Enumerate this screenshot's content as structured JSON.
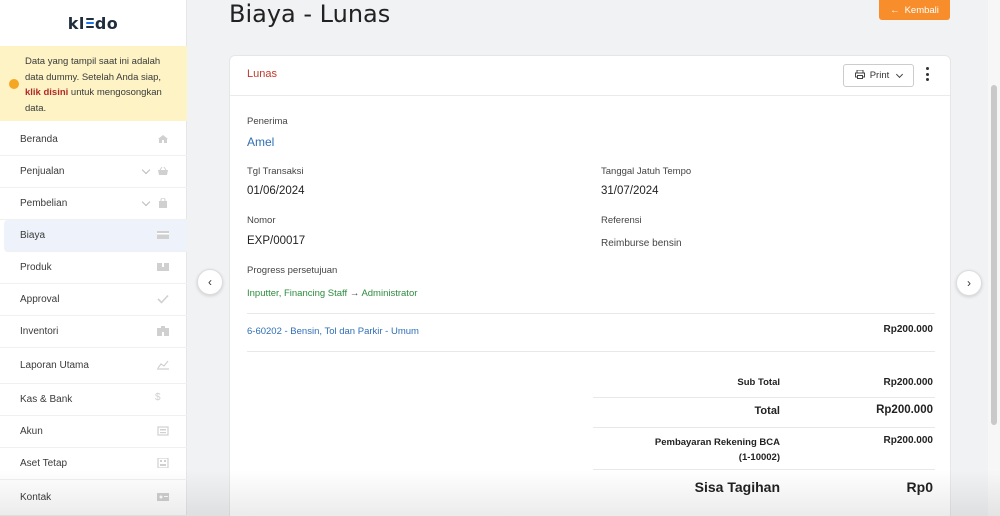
{
  "app": {
    "logo_left": "kl",
    "logo_right": "do"
  },
  "notice": {
    "text_before": "Data yang tampil saat ini adalah data dummy. Setelah Anda siap, ",
    "link": "klik disini",
    "text_after": " untuk mengosongkan data."
  },
  "sidebar": {
    "items": [
      {
        "label": "Beranda",
        "icon": "home-icon"
      },
      {
        "label": "Penjualan",
        "icon": "basket-icon",
        "chevron": true
      },
      {
        "label": "Pembelian",
        "icon": "bag-icon",
        "chevron": true
      },
      {
        "label": "Biaya",
        "icon": "card-icon",
        "active": true
      },
      {
        "label": "Produk",
        "icon": "box-icon"
      },
      {
        "label": "Approval",
        "icon": "check-icon"
      },
      {
        "label": "Inventori",
        "icon": "building-icon"
      },
      {
        "label": "Laporan Utama",
        "icon": "chart-icon"
      },
      {
        "label": "Kas & Bank",
        "icon": "dollar-icon"
      },
      {
        "label": "Akun",
        "icon": "account-icon"
      },
      {
        "label": "Aset Tetap",
        "icon": "asset-icon"
      },
      {
        "label": "Kontak",
        "icon": "contact-icon"
      }
    ]
  },
  "header": {
    "title": "Biaya - Lunas",
    "back_label": "Kembali"
  },
  "card": {
    "status": "Lunas",
    "print_label": "Print",
    "penerima_label": "Penerima",
    "penerima_value": "Amel",
    "tgl_transaksi_label": "Tgl Transaksi",
    "tgl_transaksi_value": "01/06/2024",
    "jatuh_tempo_label": "Tanggal Jatuh Tempo",
    "jatuh_tempo_value": "31/07/2024",
    "nomor_label": "Nomor",
    "nomor_value": "EXP/00017",
    "referensi_label": "Referensi",
    "referensi_value": "Reimburse bensin",
    "progress_label": "Progress persetujuan",
    "progress_from": "Inputter, Financing Staff",
    "progress_to": "Administrator",
    "line_account": "6-60202 - Bensin, Tol dan Parkir - Umum",
    "line_amount": "Rp200.000",
    "subtotal_label": "Sub Total",
    "subtotal_value": "Rp200.000",
    "total_label": "Total",
    "total_value": "Rp200.000",
    "payment_label_1": "Pembayaran Rekening BCA",
    "payment_label_2": "(1-10002)",
    "payment_value": "Rp200.000",
    "sisa_label": "Sisa Tagihan",
    "sisa_value": "Rp0"
  },
  "colors": {
    "accent": "#f78e2b",
    "link": "#2f6fb5",
    "status": "#c0392b",
    "notice_bg": "#fdf3c4"
  }
}
